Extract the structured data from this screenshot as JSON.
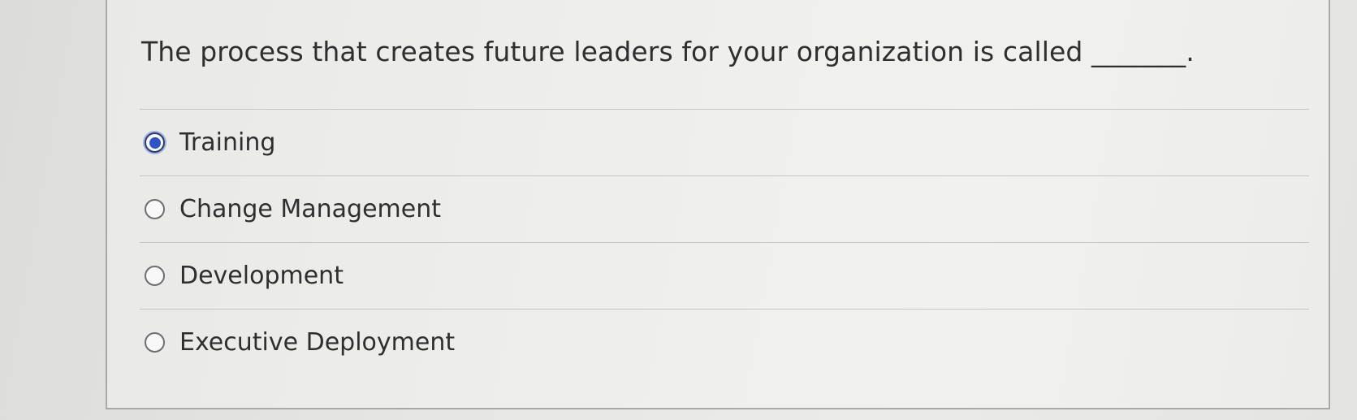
{
  "question": {
    "text": "The process that creates future leaders for your organization is called _______."
  },
  "options": [
    {
      "label": "Training",
      "selected": true
    },
    {
      "label": "Change Management",
      "selected": false
    },
    {
      "label": "Development",
      "selected": false
    },
    {
      "label": "Executive Deployment",
      "selected": false
    }
  ],
  "colors": {
    "selected_radio": "#2f52c7",
    "text": "#2f2f30",
    "divider": "#c6c6c4"
  }
}
